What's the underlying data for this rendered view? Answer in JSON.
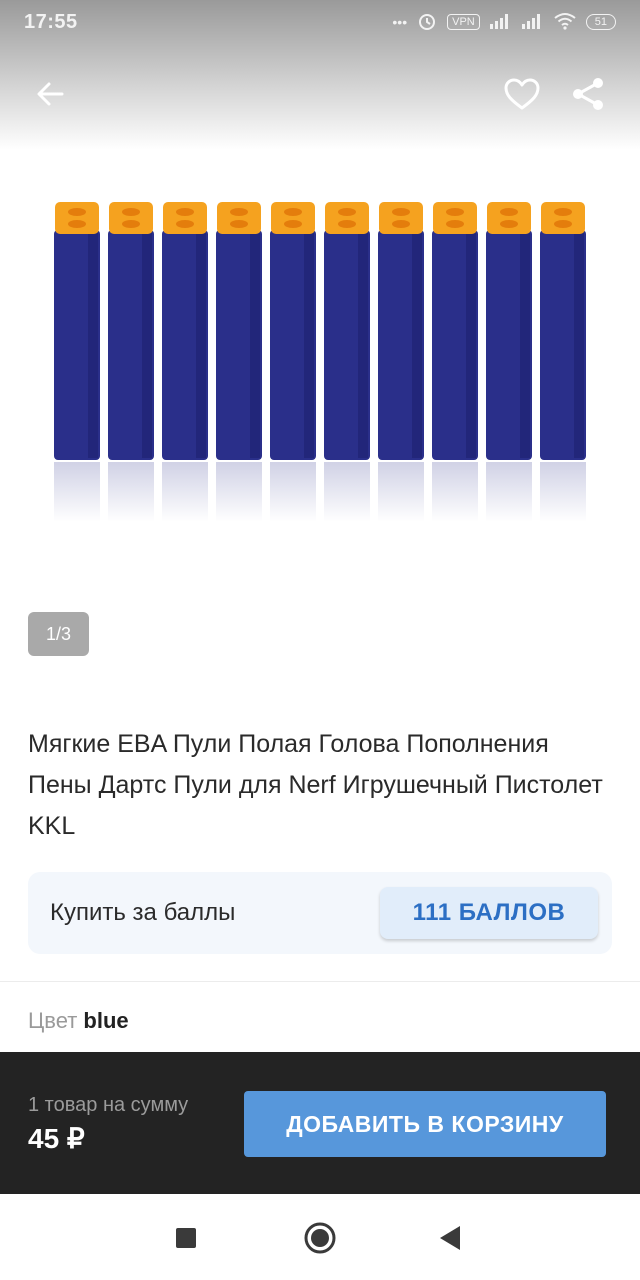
{
  "status_bar": {
    "time": "17:55",
    "icons": [
      "more-dots-icon",
      "alarm-icon",
      "vpn-icon",
      "signal-icon",
      "signal-icon",
      "wifi-icon",
      "battery-icon"
    ],
    "vpn_label": "VPN",
    "battery_label": "51"
  },
  "toolbar": {
    "icons": [
      "back-arrow-icon",
      "heart-icon",
      "share-icon"
    ]
  },
  "gallery": {
    "counter": "1/3",
    "dart_colors": {
      "body": "#2a2f8a",
      "tip": "#f5a21f"
    }
  },
  "product": {
    "title": "Мягкие EBA Пули Полая Голова Пополнения Пены Дартс Пули для Nerf Игрушечный Пистолет KKL"
  },
  "points": {
    "label": "Купить за баллы",
    "button": "111 БАЛЛОВ"
  },
  "color": {
    "label": "Цвет",
    "value": "blue"
  },
  "cart": {
    "summary_label": "1 товар на сумму",
    "summary_value": "45 ₽",
    "button": "ДОБАВИТЬ В КОРЗИНУ"
  },
  "nav": {
    "icons": [
      "recents-square-icon",
      "home-circle-icon",
      "back-triangle-icon"
    ]
  },
  "colors": {
    "accent": "#5797db",
    "points_text": "#2c6fc4",
    "bottom_bar": "#232323"
  }
}
